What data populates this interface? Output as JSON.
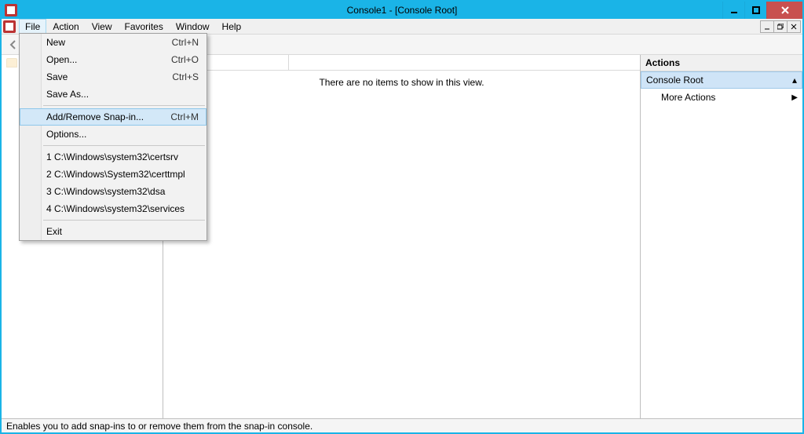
{
  "window": {
    "title": "Console1 - [Console Root]"
  },
  "menubar": {
    "items": [
      "File",
      "Action",
      "View",
      "Favorites",
      "Window",
      "Help"
    ]
  },
  "file_menu": {
    "new": {
      "label": "New",
      "shortcut": "Ctrl+N"
    },
    "open": {
      "label": "Open...",
      "shortcut": "Ctrl+O"
    },
    "save": {
      "label": "Save",
      "shortcut": "Ctrl+S"
    },
    "saveas": {
      "label": "Save As...",
      "shortcut": ""
    },
    "snapin": {
      "label": "Add/Remove Snap-in...",
      "shortcut": "Ctrl+M"
    },
    "options": {
      "label": "Options...",
      "shortcut": ""
    },
    "recent1": {
      "label": "1 C:\\Windows\\system32\\certsrv"
    },
    "recent2": {
      "label": "2 C:\\Windows\\System32\\certtmpl"
    },
    "recent3": {
      "label": "3 C:\\Windows\\system32\\dsa"
    },
    "recent4": {
      "label": "4 C:\\Windows\\system32\\services"
    },
    "exit": {
      "label": "Exit"
    }
  },
  "content": {
    "empty_message": "There are no items to show in this view."
  },
  "actions": {
    "header": "Actions",
    "group": "Console Root",
    "more": "More Actions"
  },
  "statusbar": {
    "text": "Enables you to add snap-ins to or remove them from the snap-in console."
  }
}
